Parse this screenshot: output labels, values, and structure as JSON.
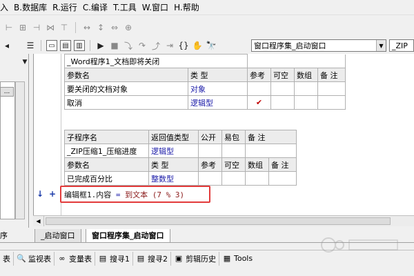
{
  "menubar": {
    "items": [
      "入",
      "B.数据库",
      "R.运行",
      "C.编译",
      "T.工具",
      "W.窗口",
      "H.帮助"
    ]
  },
  "toolbar2": {
    "combo1": "窗口程序集_启动窗口",
    "combo2": "_ZIP"
  },
  "left_panel": {
    "button_label": "..."
  },
  "table1": {
    "title": "_Word程序1_文档即将关闭",
    "headers": [
      "参数名",
      "类 型",
      "参考",
      "可空",
      "数组",
      "备 注"
    ],
    "rows": [
      {
        "name": "要关闭的文档对象",
        "type": "对象",
        "ref": "",
        "nullable": "",
        "array": "",
        "note": ""
      },
      {
        "name": "取消",
        "type": "逻辑型",
        "ref": "✔",
        "nullable": "",
        "array": "",
        "note": ""
      }
    ]
  },
  "table2": {
    "headers1": [
      "子程序名",
      "返回值类型",
      "公开",
      "易包",
      "备 注"
    ],
    "row1": {
      "name": "_ZIP压缩1_压缩进度",
      "return_type": "逻辑型"
    },
    "headers2": [
      "参数名",
      "类 型",
      "参考",
      "可空",
      "数组",
      "备 注"
    ],
    "row2": {
      "name": "已完成百分比",
      "type": "整数型"
    }
  },
  "code": {
    "line": "编辑框1.内容 = 到文本 (7 % 3)",
    "target": "编辑框1.内容",
    "op": "=",
    "func": "到文本",
    "args": "(7 % 3)"
  },
  "gutter": {
    "arrow": "↓",
    "plus": "+"
  },
  "tabs": {
    "left_partial": "序",
    "tab1": "_启动窗口",
    "tab2": "窗口程序集_启动窗口"
  },
  "bottombar": {
    "items": [
      {
        "label": "表",
        "icon": ""
      },
      {
        "label": "监视表",
        "icon": "magnifier-icon"
      },
      {
        "label": "变量表",
        "icon": "variables-icon"
      },
      {
        "label": "搜寻1",
        "icon": "search-list-icon"
      },
      {
        "label": "搜寻2",
        "icon": "search-list-icon"
      },
      {
        "label": "剪辑历史",
        "icon": "clipboard-icon"
      },
      {
        "label": "Tools",
        "icon": "tools-icon"
      }
    ]
  },
  "colors": {
    "accent_blue": "#1a1aa8",
    "highlight_red": "#e23a3a",
    "check_red": "#c00000"
  }
}
